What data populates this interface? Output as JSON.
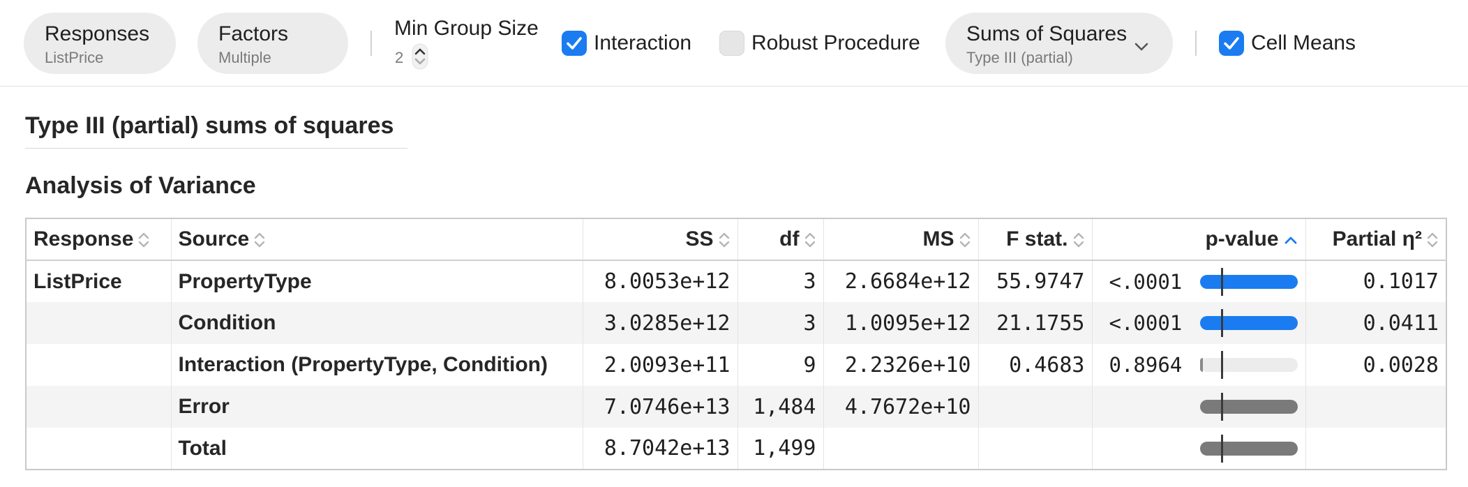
{
  "toolbar": {
    "responses": {
      "title": "Responses",
      "value": "ListPrice"
    },
    "factors": {
      "title": "Factors",
      "value": "Multiple"
    },
    "min_group_size": {
      "label": "Min Group Size",
      "value": "2"
    },
    "interaction": {
      "label": "Interaction",
      "checked": true
    },
    "robust": {
      "label": "Robust Procedure",
      "checked": false
    },
    "sums_of_squares": {
      "title": "Sums of Squares",
      "value": "Type III (partial)"
    },
    "cell_means": {
      "label": "Cell Means",
      "checked": true
    }
  },
  "main": {
    "heading": "Type III (partial) sums of squares",
    "section_title": "Analysis of Variance"
  },
  "table": {
    "columns": [
      "Response",
      "Source",
      "SS",
      "df",
      "MS",
      "F stat.",
      "p-value",
      "Partial η²"
    ],
    "sorted_column": "p-value",
    "sort_direction": "ascending",
    "rows": [
      {
        "response": "ListPrice",
        "source": "PropertyType",
        "ss": "8.0053e+12",
        "df": "3",
        "ms": "2.6684e+12",
        "f": "55.9747",
        "p": "<.0001",
        "p_fill": 1.0,
        "eta": "0.1017"
      },
      {
        "response": "",
        "source": "Condition",
        "ss": "3.0285e+12",
        "df": "3",
        "ms": "1.0095e+12",
        "f": "21.1755",
        "p": "<.0001",
        "p_fill": 1.0,
        "eta": "0.0411"
      },
      {
        "response": "",
        "source": "Interaction (PropertyType, Condition)",
        "ss": "2.0093e+11",
        "df": "9",
        "ms": "2.2326e+10",
        "f": "0.4683",
        "p": "0.8964",
        "p_fill": 0.02,
        "eta": "0.0028"
      },
      {
        "response": "",
        "source": "Error",
        "ss": "7.0746e+13",
        "df": "1,484",
        "ms": "4.7672e+10",
        "f": "",
        "p": "",
        "p_fill": 1.0,
        "eta": ""
      },
      {
        "response": "",
        "source": "Total",
        "ss": "8.7042e+13",
        "df": "1,499",
        "ms": "",
        "f": "",
        "p": "",
        "p_fill": 1.0,
        "eta": ""
      }
    ]
  },
  "colors": {
    "accent": "#1a7cf0",
    "bar_gray": "#7a7a7a",
    "bar_empty": "#ececec"
  }
}
